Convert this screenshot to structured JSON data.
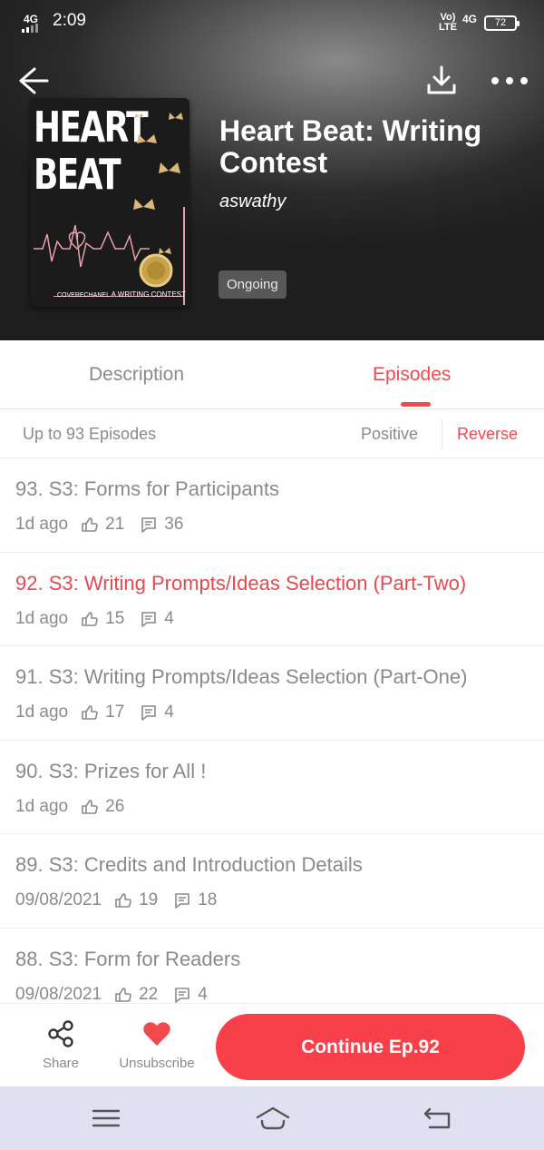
{
  "status_bar": {
    "network": "4G",
    "time": "2:09",
    "volte": "Vo) LTE",
    "network2": "4G",
    "battery": "72"
  },
  "toolbar": {
    "back_icon": "arrow-left-icon",
    "download_icon": "download-icon",
    "more_icon": "more-horizontal-icon"
  },
  "book": {
    "cover_title_line1": "HEART",
    "cover_title_line2": "BEAT",
    "cover_caption_small": "COVERECHANEL",
    "cover_caption": "A WRITING CONTEST",
    "title": "Heart Beat: Writing Contest",
    "author": "aswathy",
    "status": "Ongoing"
  },
  "tabs": {
    "description": "Description",
    "episodes": "Episodes",
    "active": "episodes"
  },
  "filter": {
    "count_label": "Up to 93 Episodes",
    "positive": "Positive",
    "reverse": "Reverse",
    "selected": "reverse"
  },
  "episodes": [
    {
      "title": "93. S3: Forms for Participants",
      "date": "1d ago",
      "likes": "21",
      "comments": "36",
      "active": false
    },
    {
      "title": "92. S3: Writing Prompts/Ideas Selection (Part-Two)",
      "date": "1d ago",
      "likes": "15",
      "comments": "4",
      "active": true
    },
    {
      "title": "91. S3: Writing Prompts/Ideas Selection (Part-One)",
      "date": "1d ago",
      "likes": "17",
      "comments": "4",
      "active": false
    },
    {
      "title": "90. S3: Prizes for All !",
      "date": "1d ago",
      "likes": "26",
      "comments": null,
      "active": false
    },
    {
      "title": "89. S3: Credits and Introduction Details",
      "date": "09/08/2021",
      "likes": "19",
      "comments": "18",
      "active": false
    },
    {
      "title": "88. S3: Form for Readers",
      "date": "09/08/2021",
      "likes": "22",
      "comments": "4",
      "active": false
    }
  ],
  "bottom_bar": {
    "share_label": "Share",
    "share_icon": "share-icon",
    "unsubscribe_label": "Unsubscribe",
    "unsubscribe_icon": "heart-icon",
    "continue_label": "Continue Ep.92"
  },
  "colors": {
    "accent": "#f04a4f",
    "continue_button": "#f7404a",
    "muted_text": "#8a8a8a",
    "nav_bar": "#dfe1f2"
  }
}
